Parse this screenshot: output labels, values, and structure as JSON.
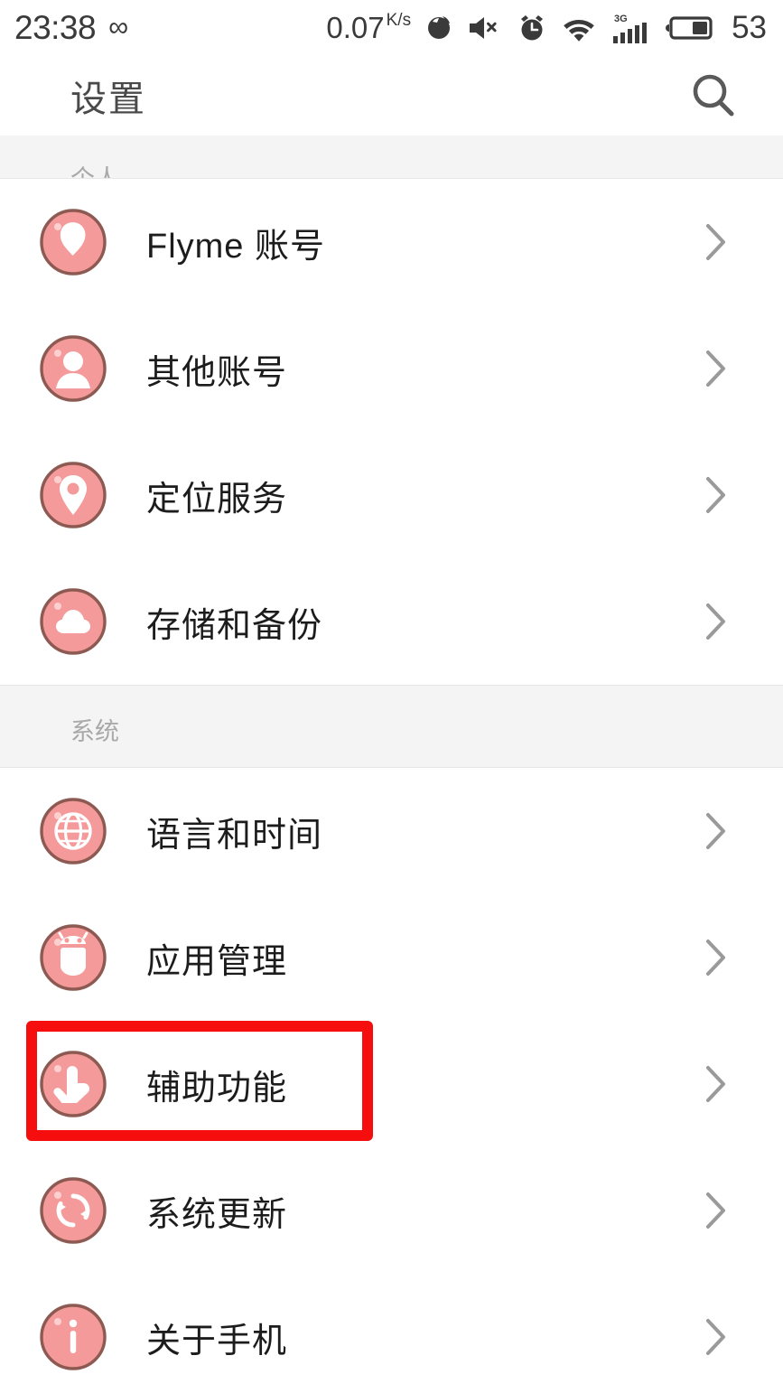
{
  "status_bar": {
    "time": "23:38",
    "infinity_icon": "infinity-icon",
    "network_speed": "0.07",
    "network_speed_unit_num": "K",
    "network_speed_unit_den": "s",
    "icons": [
      "data-saver-icon",
      "mute-icon",
      "alarm-icon",
      "wifi-icon",
      "signal-3g-icon",
      "battery-icon"
    ],
    "signal_label": "3G",
    "battery_level": "53"
  },
  "header": {
    "title": "设置",
    "search_icon": "search-icon"
  },
  "sections": [
    {
      "label": "个人",
      "clipped": true,
      "items": [
        {
          "label": "Flyme 账号",
          "icon": "flyme-logo-icon"
        },
        {
          "label": "其他账号",
          "icon": "person-icon"
        },
        {
          "label": "定位服务",
          "icon": "location-pin-icon"
        },
        {
          "label": "存储和备份",
          "icon": "cloud-icon"
        }
      ]
    },
    {
      "label": "系统",
      "clipped": false,
      "items": [
        {
          "label": "语言和时间",
          "icon": "globe-icon"
        },
        {
          "label": "应用管理",
          "icon": "android-robot-icon"
        },
        {
          "label": "辅助功能",
          "icon": "hand-tap-icon",
          "highlighted": true
        },
        {
          "label": "系统更新",
          "icon": "refresh-icon"
        },
        {
          "label": "关于手机",
          "icon": "info-icon"
        }
      ]
    }
  ],
  "colors": {
    "icon_fill": "#f59a9a",
    "icon_border": "#8c5a52",
    "highlight_box": "#f60d0d",
    "section_bg": "#f4f4f4",
    "section_text": "#a9a9a9",
    "row_text": "#1c1c1c",
    "chevron": "#9a9a9a"
  }
}
